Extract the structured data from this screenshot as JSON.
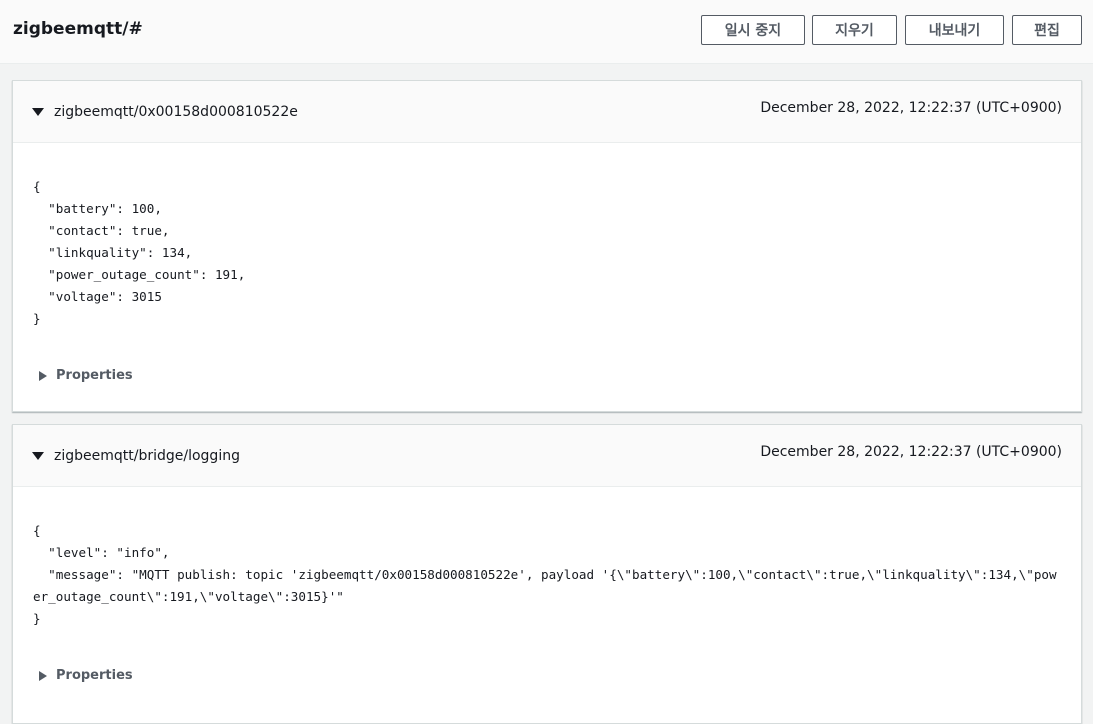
{
  "header": {
    "topic": "zigbeemqtt/#",
    "buttons": {
      "pause": "일시 중지",
      "clear": "지우기",
      "export": "내보내기",
      "edit": "편집"
    }
  },
  "messages": [
    {
      "topic": "zigbeemqtt/0x00158d000810522e",
      "timestamp": "December 28, 2022, 12:22:37 (UTC+0900)",
      "payload": "{\n  \"battery\": 100,\n  \"contact\": true,\n  \"linkquality\": 134,\n  \"power_outage_count\": 191,\n  \"voltage\": 3015\n}",
      "properties_label": "Properties"
    },
    {
      "topic": "zigbeemqtt/bridge/logging",
      "timestamp": "December 28, 2022, 12:22:37 (UTC+0900)",
      "payload": "{\n  \"level\": \"info\",\n  \"message\": \"MQTT publish: topic 'zigbeemqtt/0x00158d000810522e', payload '{\\\"battery\\\":100,\\\"contact\\\":true,\\\"linkquality\\\":134,\\\"power_outage_count\\\":191,\\\"voltage\\\":3015}'\"\n}",
      "properties_label": "Properties"
    }
  ],
  "icons": {
    "expand_down": "caret-down-icon",
    "collapse_right": "caret-right-icon"
  },
  "colors": {
    "page_background": "#f2f3f3",
    "card_background": "#ffffff",
    "header_background": "#fafafa",
    "border": "#d5dbdb",
    "button_text": "#545b64",
    "text": "#16191f"
  }
}
